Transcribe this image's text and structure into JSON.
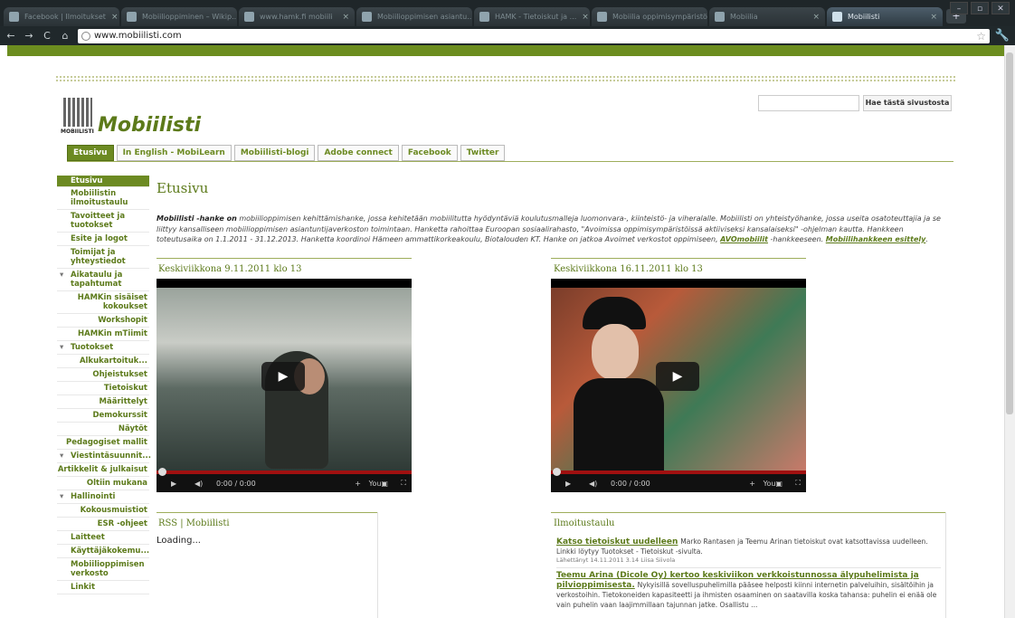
{
  "browser": {
    "tabs": [
      {
        "label": "Facebook | Ilmoitukset"
      },
      {
        "label": "Mobiilioppiminen – Wikip..."
      },
      {
        "label": "www.hamk.fi mobiili"
      },
      {
        "label": "Mobiilioppimisen asiantu..."
      },
      {
        "label": "HAMK - Tietoiskut ja ..."
      },
      {
        "label": "Mobiilia oppimisympäristö..."
      },
      {
        "label": "Mobiilia"
      },
      {
        "label": "Mobiilisti"
      }
    ],
    "new_tab": "+",
    "url": "www.mobiilisti.com"
  },
  "site": {
    "title": "Mobiilisti",
    "logo_text": "MOBIILISTI",
    "search_button": "Hae tästä sivustosta",
    "search_placeholder": ""
  },
  "nav": [
    "Etusivu",
    "In English - MobiLearn",
    "Mobiilisti-blogi",
    "Adobe connect",
    "Facebook",
    "Twitter"
  ],
  "sidebar": [
    {
      "label": "Etusivu",
      "kind": "cur"
    },
    {
      "label": "Mobiilistin ilmoitustaulu",
      "kind": "top"
    },
    {
      "label": "Tavoitteet ja tuotokset",
      "kind": "top"
    },
    {
      "label": "Esite ja logot",
      "kind": "top"
    },
    {
      "label": "Toimijat ja yhteystiedot",
      "kind": "top"
    },
    {
      "label": "Aikataulu ja tapahtumat",
      "kind": "sec"
    },
    {
      "label": "HAMKin sisäiset kokoukset",
      "kind": "subr"
    },
    {
      "label": "Workshopit",
      "kind": "subr"
    },
    {
      "label": "HAMKin mTiimit",
      "kind": "subr"
    },
    {
      "label": "Tuotokset",
      "kind": "sec"
    },
    {
      "label": "Alkukartoituk...",
      "kind": "subr"
    },
    {
      "label": "Ohjeistukset",
      "kind": "subr"
    },
    {
      "label": "Tietoiskut",
      "kind": "subr"
    },
    {
      "label": "Määrittelyt",
      "kind": "subr"
    },
    {
      "label": "Demokurssit",
      "kind": "subr"
    },
    {
      "label": "Näytöt",
      "kind": "subr"
    },
    {
      "label": "Pedagogiset mallit",
      "kind": "subr"
    },
    {
      "label": "Viestintäsuunnit...",
      "kind": "sec"
    },
    {
      "label": "Artikkelit & julkaisut",
      "kind": "subr"
    },
    {
      "label": "Oltiin mukana",
      "kind": "subr"
    },
    {
      "label": "Hallinointi",
      "kind": "sec"
    },
    {
      "label": "Kokousmuistiot",
      "kind": "subr"
    },
    {
      "label": "ESR -ohjeet",
      "kind": "subr"
    },
    {
      "label": "Laitteet",
      "kind": "top"
    },
    {
      "label": "Käyttäjäkokemu...",
      "kind": "top"
    },
    {
      "label": "Mobiilioppimisen verkosto",
      "kind": "top"
    },
    {
      "label": "Linkit",
      "kind": "top"
    }
  ],
  "main": {
    "heading": "Etusivu",
    "intro": {
      "bold": "Mobiilisti -hanke on",
      "text": " mobiilioppimisen kehittämishanke, jossa kehitetään mobiilitutta hyödyntäviä koulutusmalleja luomonvara-, kiinteistö- ja viheralalle. Mobiilisti on yhteistyöhanke, jossa useita osatoteuttajia ja se liittyy kansalliseen mobiilioppimisen asiantuntijaverkoston toimintaan. Hanketta rahoittaa Euroopan sosiaalirahasto, \"Avoimissa oppimisympäristöissä aktiiviseksi kansalaiseksi\" -ohjelman kautta. Hankkeen toteutusaika on 1.1.2011 - 31.12.2013. Hanketta koordinoi Hämeen ammattikorkeakoulu, Biotalouden KT. Hanke on jatkoa Avoimet verkostot oppimiseen, ",
      "link1": "AVOmobiilit",
      "mid": " -hankkeeseen. ",
      "link2": "Mobiilihankkeen esittely",
      "end": "."
    },
    "videos": [
      {
        "title": "Keskiviikkona 9.11.2011 klo 13",
        "time": "0:00 / 0:00"
      },
      {
        "title": "Keskiviikkona 16.11.2011 klo 13",
        "time": "0:00 / 0:00"
      }
    ],
    "rss": {
      "title": "RSS | Mobiilisti",
      "status": "Loading..."
    },
    "ilmoitustaulu": {
      "title": "Ilmoitustaulu",
      "items": [
        {
          "title": "Katso tietoiskut uudelleen",
          "body": "Marko Rantasen ja Teemu Arinan tietoiskut ovat katsottavissa uudelleen. Linkki löytyy Tuotokset - Tietoiskut -sivulta.",
          "meta": "Lähettänyt 14.11.2011 3.14 Liisa Siivola"
        },
        {
          "title": "Teemu Arina (Dicole Oy) kertoo keskiviikon verkkoistunnossa älypuhelimista ja pilvioppimisesta.",
          "body": "Nykyisillä sovelluspuhelimilla pääsee helposti kiinni internetin palveluihin, sisältöihin ja verkostoihin. Tietokoneiden kapasiteetti ja ihmisten osaaminen on saatavilla koska tahansa: puhelin ei enää ole vain puhelin vaan laajimmillaan tajunnan jatke. Osallistu ...",
          "meta": ""
        }
      ]
    }
  },
  "colors": {
    "brand": "#6c8a22",
    "chrome": "#1f2629"
  }
}
